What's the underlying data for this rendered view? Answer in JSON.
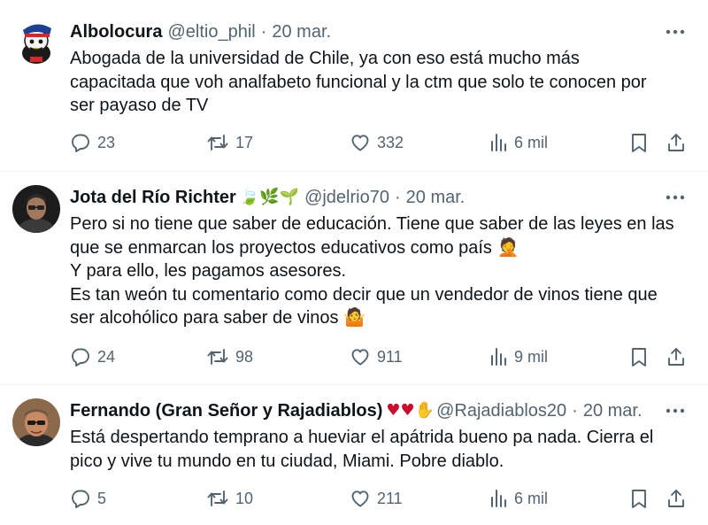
{
  "tweets": [
    {
      "name": "Albolocura",
      "name_emoji": "",
      "handle": "@eltio_phil",
      "dot": "·",
      "time": "20 mar.",
      "lines": [
        "Abogada de la universidad de Chile, ya con eso está mucho más",
        "capacitada que voh analfabeto funcional y la ctm que solo te conocen por",
        "ser payaso de TV"
      ],
      "replies": "23",
      "retweets": "17",
      "likes": "332",
      "views": "6 mil"
    },
    {
      "name": "Jota del Río Richter",
      "name_emoji": "🍃🌿🌱",
      "handle": "@jdelrio70",
      "dot": "·",
      "time": "20 mar.",
      "lines": [
        "Pero si no tiene que saber de educación. Tiene que saber de las leyes en las",
        "que se enmarcan los proyectos educativos como país 🤦",
        "Y para ello, les pagamos asesores.",
        "Es tan weón tu comentario como decir que un vendedor de vinos tiene que",
        "ser alcohólico para saber de vinos 🤷"
      ],
      "replies": "24",
      "retweets": "98",
      "likes": "911",
      "views": "9 mil"
    },
    {
      "name": "Fernando (Gran Señor y Rajadiablos)",
      "name_emoji": "♥♥✋",
      "handle": "@Rajadiablos20",
      "dot": "·",
      "time": "20 mar.",
      "lines": [
        "Está despertando temprano a hueviar el apátrida bueno pa nada. Cierra el",
        "pico y vive tu mundo en tu ciudad, Miami. Pobre diablo."
      ],
      "replies": "5",
      "retweets": "10",
      "likes": "211",
      "views": "6 mil"
    }
  ],
  "colors": {
    "text": "#0f1419",
    "secondary": "#536471",
    "divider": "#eff3f4",
    "heart": "#e0245e"
  },
  "icons": {
    "reply": "reply-icon",
    "retweet": "retweet-icon",
    "like": "like-icon",
    "views": "views-icon",
    "bookmark": "bookmark-icon",
    "share": "share-icon",
    "more": "more-icon"
  }
}
